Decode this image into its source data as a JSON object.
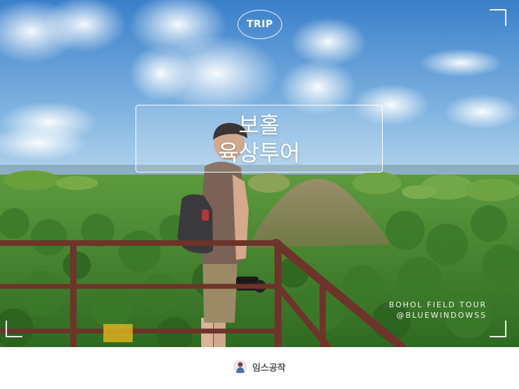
{
  "badge": {
    "label": "TRIP"
  },
  "title": {
    "line1": "보홀",
    "line2": "육상투어"
  },
  "caption": {
    "line1": "BOHOL FIELD TOUR",
    "line2": "@BLUEWINDOWSS"
  },
  "credit": {
    "name": "임스공작"
  },
  "colors": {
    "sky_top": "#3f86cf",
    "sky_bottom": "#a9cdea",
    "hills": "#5f9a3a",
    "railing": "#7a3a2e"
  }
}
